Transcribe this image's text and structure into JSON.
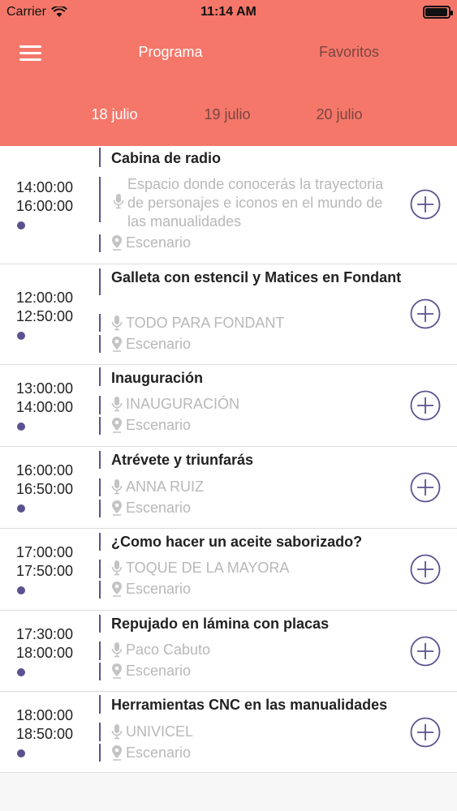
{
  "status_bar": {
    "carrier": "Carrier",
    "time": "11:14 AM",
    "battery_level": 0.95
  },
  "nav": {
    "tabs": [
      "Programa",
      "Favoritos"
    ],
    "active_tab": "Programa"
  },
  "dates": {
    "tabs": [
      "18 julio",
      "19 julio",
      "20 julio"
    ],
    "active": "18 julio"
  },
  "colors": {
    "header": "#f5776a",
    "accent": "#5a5290",
    "muted": "#b8b8b8"
  },
  "events": [
    {
      "start": "14:00:00",
      "end": "16:00:00",
      "title": "Cabina de radio",
      "description": "Espacio donde conocerás la trayectoria de personajes e iconos en el mundo de las manualidades",
      "speaker": "",
      "location": "Escenario"
    },
    {
      "start": "12:00:00",
      "end": "12:50:00",
      "title": "Galleta con estencil y Matices en Fondant",
      "description": "",
      "speaker": "TODO PARA FONDANT",
      "location": "Escenario"
    },
    {
      "start": "13:00:00",
      "end": "14:00:00",
      "title": "Inauguración",
      "description": "",
      "speaker": "INAUGURACIÓN",
      "location": "Escenario"
    },
    {
      "start": "16:00:00",
      "end": "16:50:00",
      "title": "Atrévete y triunfarás",
      "description": "",
      "speaker": "ANNA RUIZ",
      "location": "Escenario"
    },
    {
      "start": "17:00:00",
      "end": "17:50:00",
      "title": "¿Como hacer un aceite saborizado?",
      "description": "",
      "speaker": "TOQUE DE LA MAYORA",
      "location": "Escenario"
    },
    {
      "start": "17:30:00",
      "end": "18:00:00",
      "title": "Repujado en lámina con placas",
      "description": "",
      "speaker": "Paco Cabuto",
      "location": "Escenario"
    },
    {
      "start": "18:00:00",
      "end": "18:50:00",
      "title": "Herramientas CNC en las manualidades",
      "description": "",
      "speaker": "UNIVICEL",
      "location": "Escenario"
    }
  ]
}
